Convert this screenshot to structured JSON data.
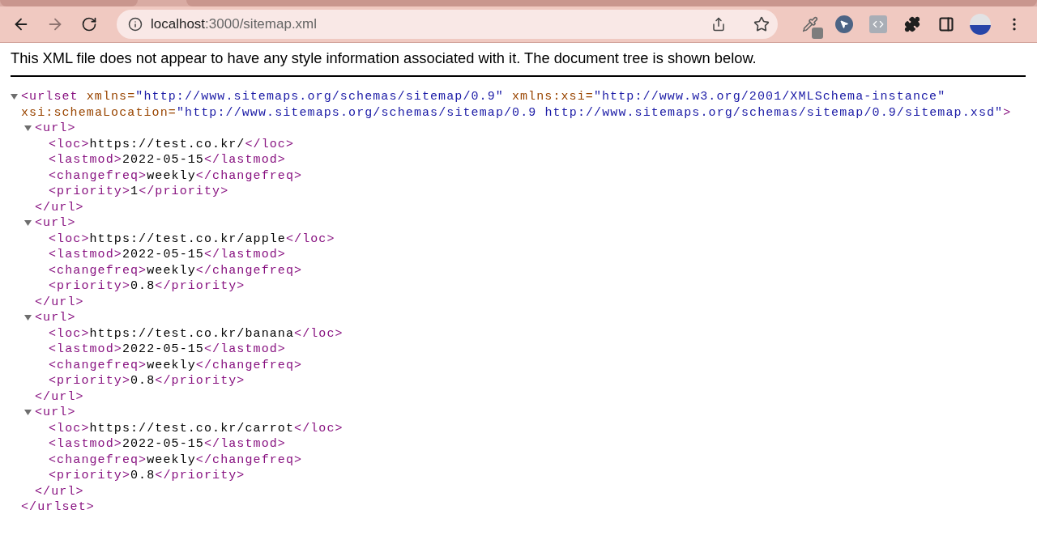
{
  "browser": {
    "url_host": "localhost",
    "url_path": ":3000/sitemap.xml"
  },
  "notice": "This XML file does not appear to have any style information associated with it. The document tree is shown below.",
  "tree": {
    "open_tag": "<urlset",
    "expanded": true,
    "attribute_lines": [
      [
        {
          "name": "xmlns=",
          "value": "\"http://www.sitemaps.org/schemas/sitemap/0.9\""
        },
        {
          "name": "xmlns:xsi=",
          "value": "\"http://www.w3.org/2001/XMLSchema-instance\""
        }
      ],
      [
        {
          "name": "xsi:schemaLocation=",
          "value": "\"http://www.sitemaps.org/schemas/sitemap/0.9 http://www.sitemaps.org/schemas/sitemap/0.9/sitemap.xsd\""
        }
      ]
    ],
    "open_tag_end": ">",
    "close_tag": "</urlset>",
    "children": [
      {
        "open_tag": "<url>",
        "expanded": true,
        "close_tag": "</url>",
        "children": [
          {
            "open_tag": "<loc>",
            "text": "https://test.co.kr/",
            "close_tag": "</loc>"
          },
          {
            "open_tag": "<lastmod>",
            "text": "2022-05-15",
            "close_tag": "</lastmod>"
          },
          {
            "open_tag": "<changefreq>",
            "text": "weekly",
            "close_tag": "</changefreq>"
          },
          {
            "open_tag": "<priority>",
            "text": "1",
            "close_tag": "</priority>"
          }
        ]
      },
      {
        "open_tag": "<url>",
        "expanded": true,
        "close_tag": "</url>",
        "children": [
          {
            "open_tag": "<loc>",
            "text": "https://test.co.kr/apple",
            "close_tag": "</loc>"
          },
          {
            "open_tag": "<lastmod>",
            "text": "2022-05-15",
            "close_tag": "</lastmod>"
          },
          {
            "open_tag": "<changefreq>",
            "text": "weekly",
            "close_tag": "</changefreq>"
          },
          {
            "open_tag": "<priority>",
            "text": "0.8",
            "close_tag": "</priority>"
          }
        ]
      },
      {
        "open_tag": "<url>",
        "expanded": true,
        "close_tag": "</url>",
        "children": [
          {
            "open_tag": "<loc>",
            "text": "https://test.co.kr/banana",
            "close_tag": "</loc>"
          },
          {
            "open_tag": "<lastmod>",
            "text": "2022-05-15",
            "close_tag": "</lastmod>"
          },
          {
            "open_tag": "<changefreq>",
            "text": "weekly",
            "close_tag": "</changefreq>"
          },
          {
            "open_tag": "<priority>",
            "text": "0.8",
            "close_tag": "</priority>"
          }
        ]
      },
      {
        "open_tag": "<url>",
        "expanded": true,
        "close_tag": "</url>",
        "children": [
          {
            "open_tag": "<loc>",
            "text": "https://test.co.kr/carrot",
            "close_tag": "</loc>"
          },
          {
            "open_tag": "<lastmod>",
            "text": "2022-05-15",
            "close_tag": "</lastmod>"
          },
          {
            "open_tag": "<changefreq>",
            "text": "weekly",
            "close_tag": "</changefreq>"
          },
          {
            "open_tag": "<priority>",
            "text": "0.8",
            "close_tag": "</priority>"
          }
        ]
      }
    ]
  }
}
